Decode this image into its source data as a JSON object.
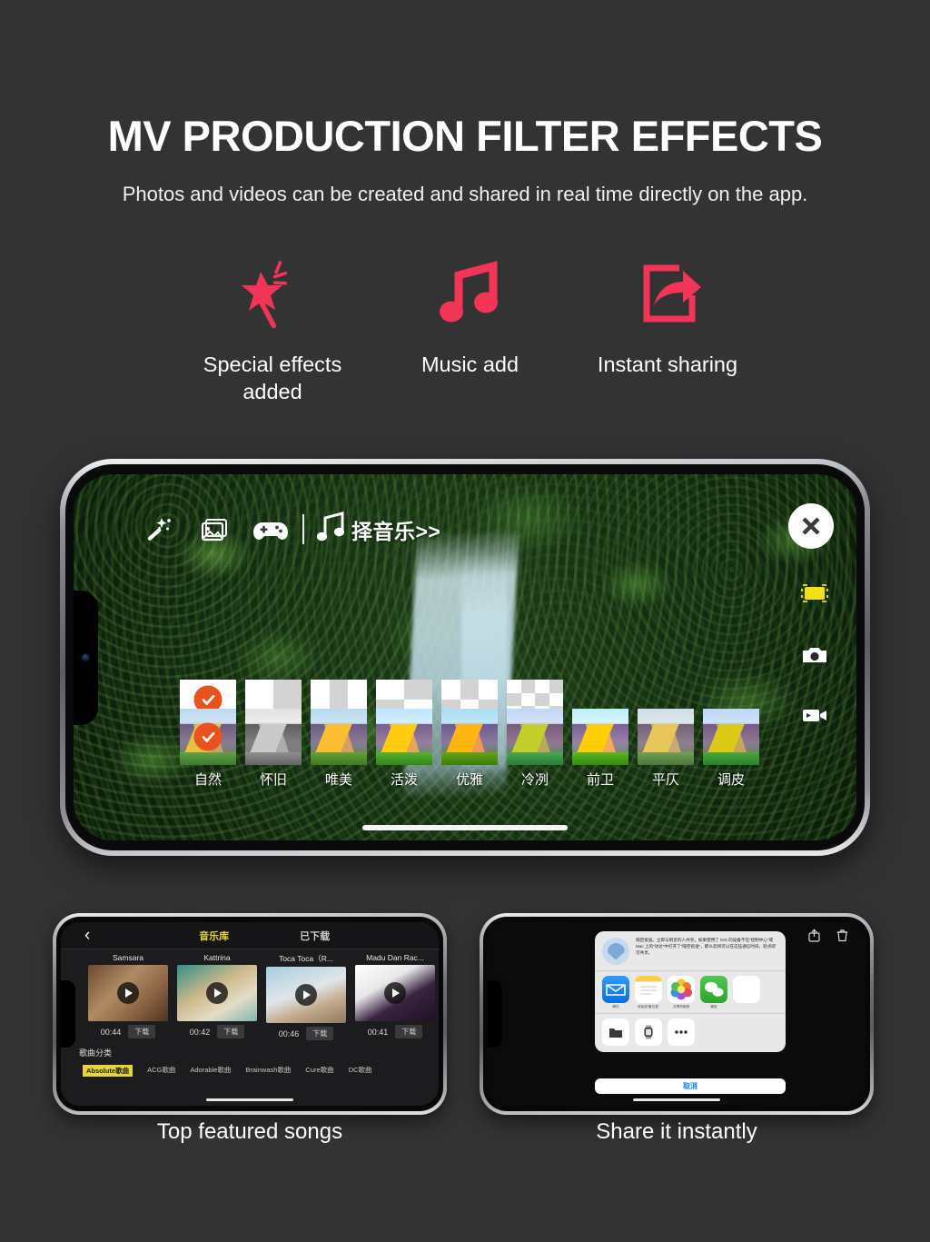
{
  "header": {
    "title": "MV PRODUCTION FILTER EFFECTS",
    "subtitle": "Photos and videos can be created and shared in real time directly on the app."
  },
  "features": [
    {
      "icon": "magic-wand-star-icon",
      "label": "Special effects\nadded"
    },
    {
      "icon": "music-note-icon",
      "label": "Music add"
    },
    {
      "icon": "share-arrow-icon",
      "label": "Instant sharing"
    }
  ],
  "colors": {
    "background": "#333333",
    "accent_pink": "#F23457",
    "accent_orange": "#E8521E",
    "accent_yellow": "#E8D53A",
    "ios_blue": "#0A7CFF"
  },
  "editor": {
    "toolbar": [
      {
        "name": "magic-wand-icon",
        "label": ""
      },
      {
        "name": "image-icon",
        "label": ""
      },
      {
        "name": "gamepad-icon",
        "label": ""
      },
      {
        "name": "music-note-icon",
        "label": ""
      }
    ],
    "music_label": "择音乐>>",
    "close_label": "×",
    "side_icons": [
      {
        "name": "filmstrip-frame-icon",
        "active": true
      },
      {
        "name": "camera-icon",
        "active": false
      },
      {
        "name": "video-camera-icon",
        "active": false
      }
    ],
    "layout_thumbs": [
      {
        "name": "layout-single",
        "selected": true,
        "cells": [
          "w"
        ],
        "cols": 1,
        "rows": 1
      },
      {
        "name": "layout-2col",
        "selected": false,
        "cells": [
          "w",
          "g"
        ],
        "cols": 2,
        "rows": 1
      },
      {
        "name": "layout-3col",
        "selected": false,
        "cells": [
          "w",
          "g",
          "w"
        ],
        "cols": 3,
        "rows": 1
      },
      {
        "name": "layout-2x2",
        "selected": false,
        "cells": [
          "w",
          "g",
          "g",
          "w"
        ],
        "cols": 2,
        "rows": 2
      },
      {
        "name": "layout-3x2",
        "selected": false,
        "cells": [
          "w",
          "g",
          "w",
          "g",
          "w",
          "g"
        ],
        "cols": 3,
        "rows": 2
      },
      {
        "name": "layout-4x3",
        "selected": false,
        "cells": [
          "w",
          "g",
          "w",
          "g",
          "g",
          "w",
          "g",
          "w",
          "w",
          "g",
          "w",
          "g"
        ],
        "cols": 4,
        "rows": 3
      }
    ],
    "filters": [
      {
        "label": "自然",
        "selected": true,
        "style": "natural"
      },
      {
        "label": "怀旧",
        "selected": false,
        "style": "nostalgic-bw"
      },
      {
        "label": "唯美",
        "selected": false,
        "style": "beautiful"
      },
      {
        "label": "活泼",
        "selected": false,
        "style": "lively"
      },
      {
        "label": "优雅",
        "selected": false,
        "style": "elegant"
      },
      {
        "label": "冷冽",
        "selected": false,
        "style": "cool"
      },
      {
        "label": "前卫",
        "selected": false,
        "style": "avant-garde"
      },
      {
        "label": "平仄",
        "selected": false,
        "style": "tonal"
      },
      {
        "label": "调皮",
        "selected": false,
        "style": "playful"
      }
    ]
  },
  "music_library": {
    "back_label": "‹",
    "tabs": [
      {
        "label": "音乐库",
        "active": true
      },
      {
        "label": "已下载",
        "active": false
      }
    ],
    "songs": [
      {
        "title": "Samsara",
        "duration": "00:44",
        "download_label": "下载"
      },
      {
        "title": "Kattrina",
        "duration": "00:42",
        "download_label": "下载"
      },
      {
        "title": "Toca Toca（R...",
        "duration": "00:46",
        "download_label": "下载"
      },
      {
        "title": "Madu Dan Rac...",
        "duration": "00:41",
        "download_label": "下载"
      }
    ],
    "category_heading": "歌曲分类",
    "categories": [
      {
        "label": "Absolute歌曲",
        "active": true
      },
      {
        "label": "ACG歌曲",
        "active": false
      },
      {
        "label": "Adorable歌曲",
        "active": false
      },
      {
        "label": "Brainwash歌曲",
        "active": false
      },
      {
        "label": "Cure歌曲",
        "active": false
      },
      {
        "label": "DC歌曲",
        "active": false
      }
    ],
    "caption": "Top featured songs"
  },
  "share_sheet": {
    "top_icons": [
      {
        "name": "share-icon"
      },
      {
        "name": "trash-icon"
      }
    ],
    "airdrop_text": "隔空投送。立即与附近的人共享。如果使用了 iOS 的设备不在“控制中心”或 Mac 上的“访达”中打开了“隔空投送”，那么您将可以在这些通信时间，轻点即可共享。",
    "apps": [
      {
        "icon": "mail-icon",
        "label": "邮件"
      },
      {
        "icon": "notes-icon",
        "label": "添加到“备忘录”"
      },
      {
        "icon": "photos-icon",
        "label": "共享的相簿"
      },
      {
        "icon": "wechat-icon",
        "label": "微信"
      },
      {
        "icon": "more-app-icon",
        "label": ""
      }
    ],
    "actions": [
      {
        "icon": "files-icon"
      },
      {
        "icon": "watch-icon"
      },
      {
        "icon": "more-icon"
      }
    ],
    "cancel_label": "取消",
    "caption": "Share it instantly"
  }
}
